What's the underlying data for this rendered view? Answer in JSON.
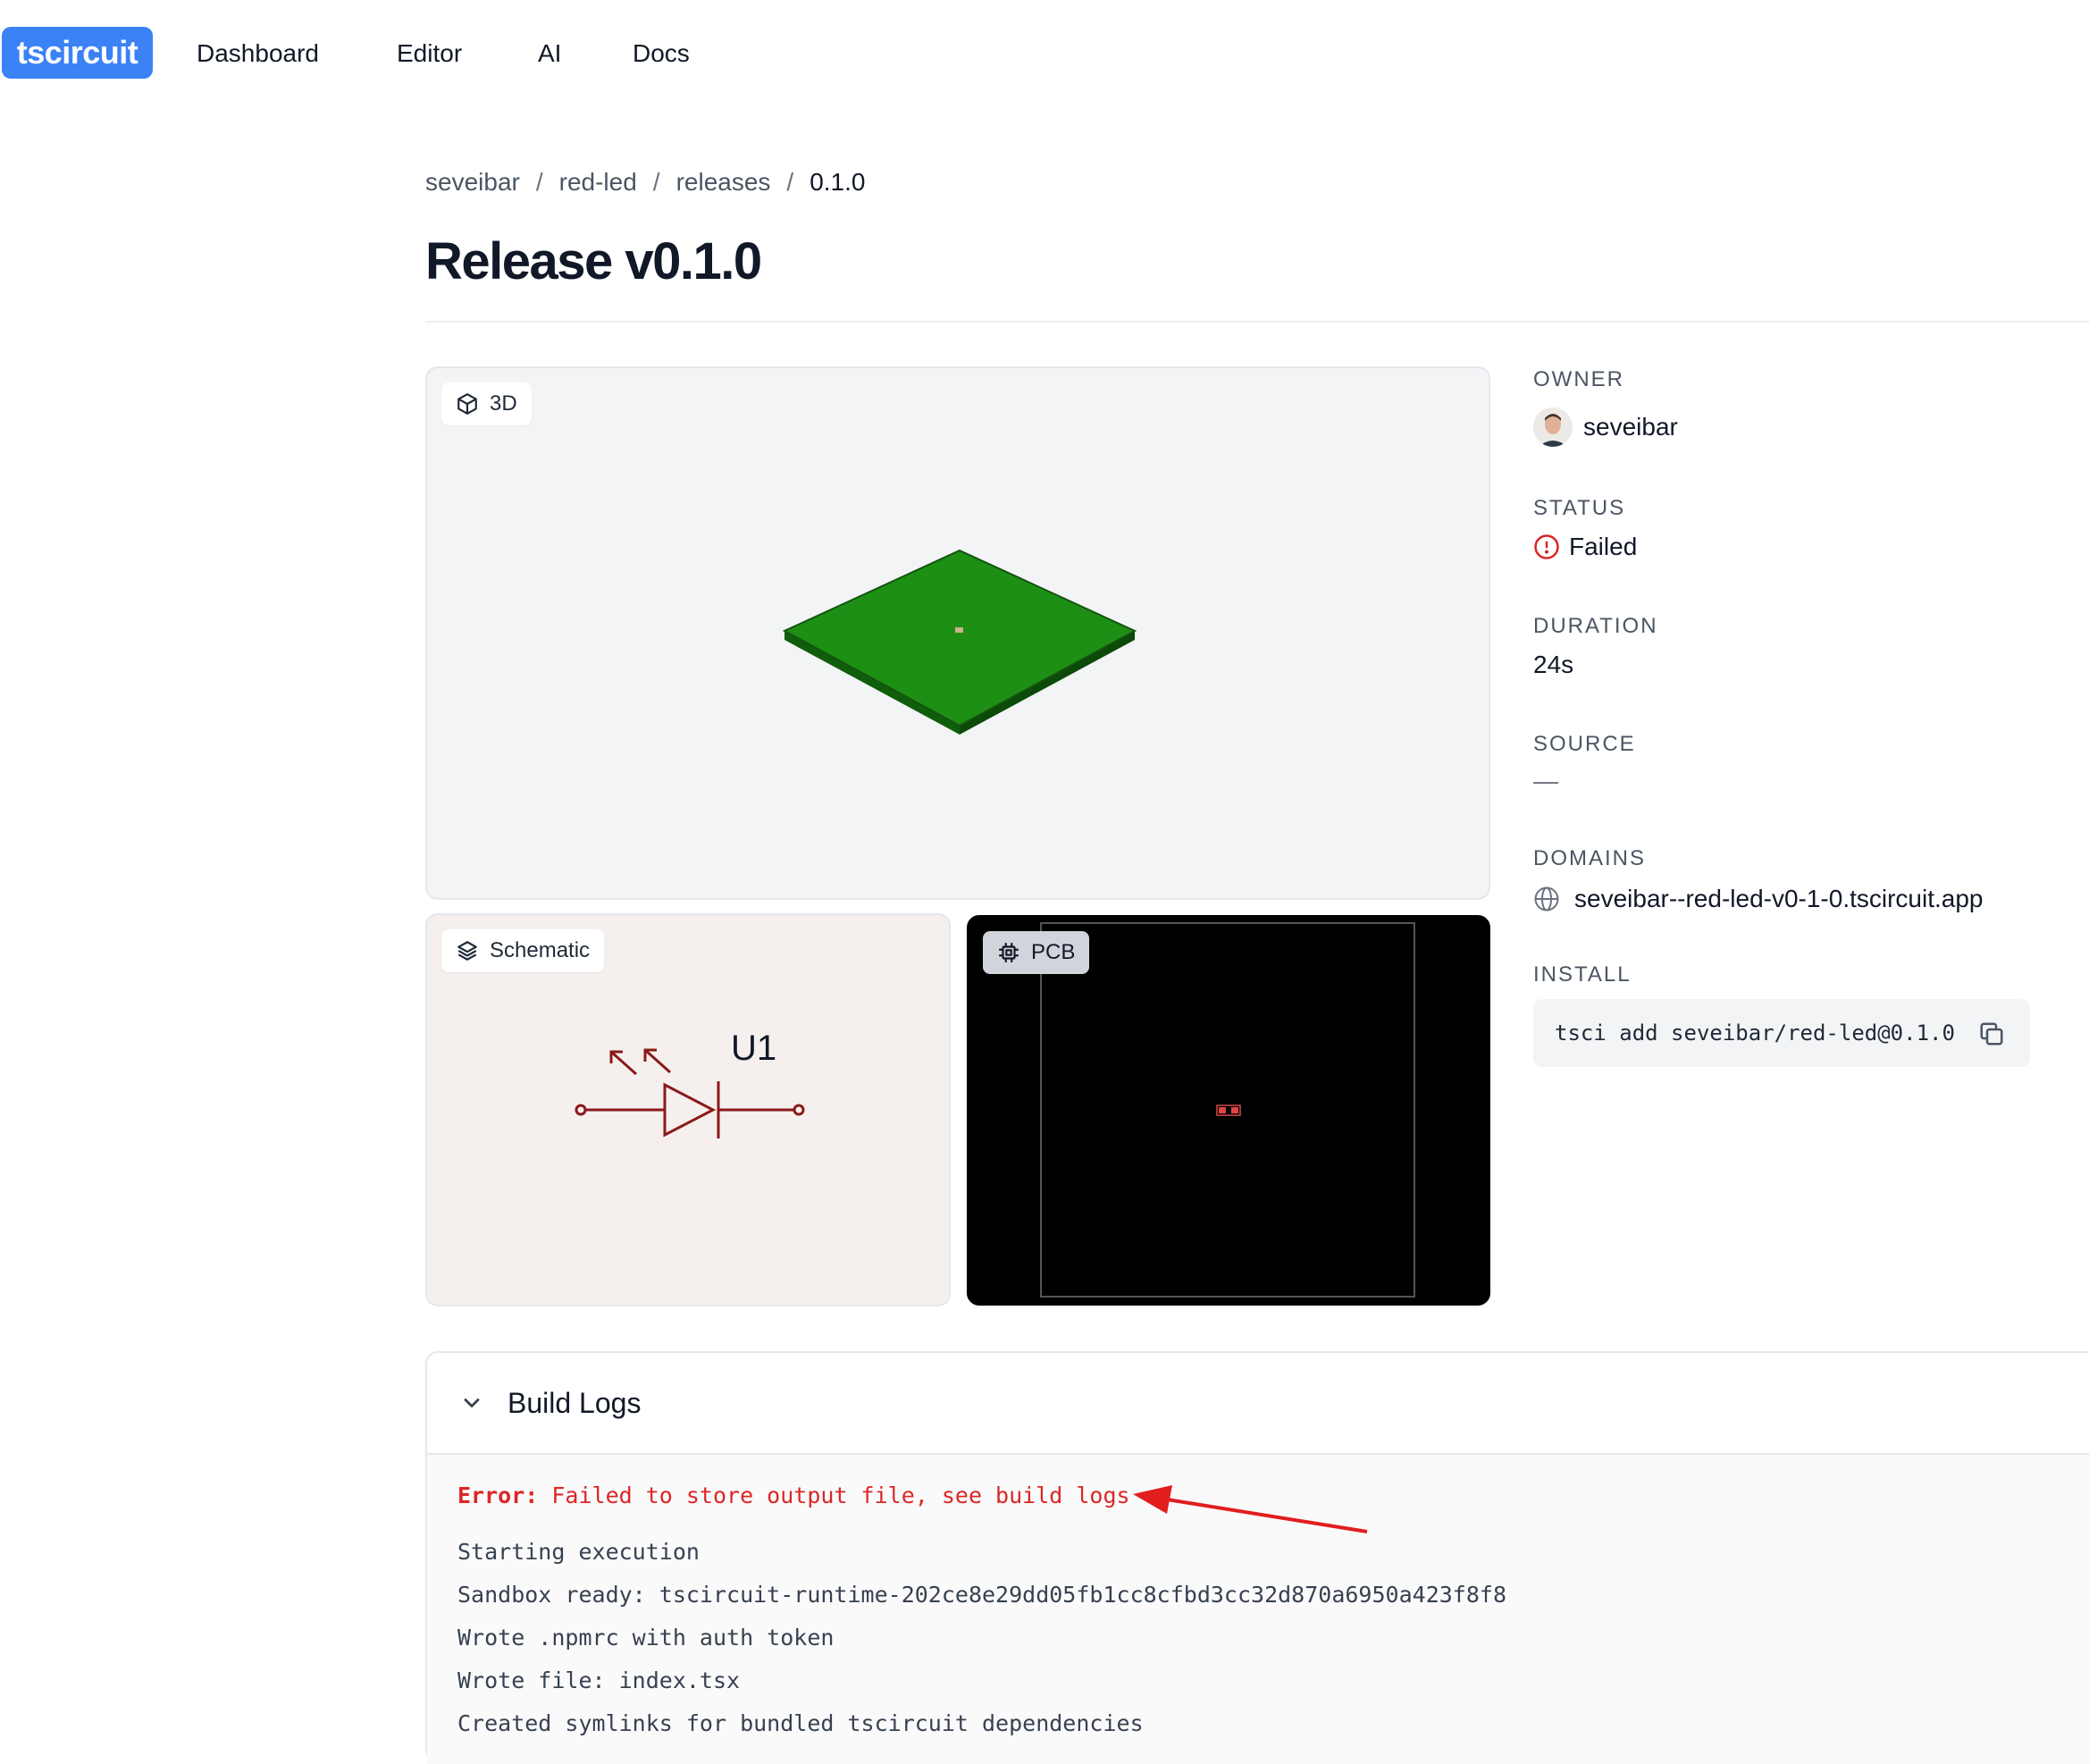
{
  "nav": {
    "logo": "tscircuit",
    "links": [
      "Dashboard",
      "Editor",
      "AI",
      "Docs"
    ]
  },
  "breadcrumb": [
    "seveibar",
    "red-led",
    "releases",
    "0.1.0"
  ],
  "breadcrumb_separator": "/",
  "page_title": "Release v0.1.0",
  "previews": {
    "three_d_label": "3D",
    "schematic_label": "Schematic",
    "schematic_ref": "U1",
    "pcb_label": "PCB"
  },
  "details": {
    "owner_label": "OWNER",
    "owner_name": "seveibar",
    "status_label": "STATUS",
    "status_value": "Failed",
    "duration_label": "DURATION",
    "duration_value": "24s",
    "source_label": "SOURCE",
    "source_value": "—",
    "domains_label": "DOMAINS",
    "domain_value": "seveibar--red-led-v0-1-0.tscircuit.app",
    "install_label": "INSTALL",
    "install_command": "tsci add seveibar/red-led@0.1.0"
  },
  "build_logs": {
    "title": "Build Logs",
    "error_prefix": "Error:",
    "error_message": " Failed to store output file, see build logs",
    "lines": [
      "Starting execution",
      "Sandbox ready: tscircuit-runtime-202ce8e29dd05fb1cc8cfbd3cc32d870a6950a423f8f8",
      "Wrote .npmrc with auth token",
      "Wrote file: index.tsx",
      "Created symlinks for bundled tscircuit dependencies"
    ]
  },
  "colors": {
    "brand": "#3b82f6",
    "error": "#dc2626",
    "board_green": "#1d8f14",
    "schematic_red": "#8b1a1a"
  }
}
